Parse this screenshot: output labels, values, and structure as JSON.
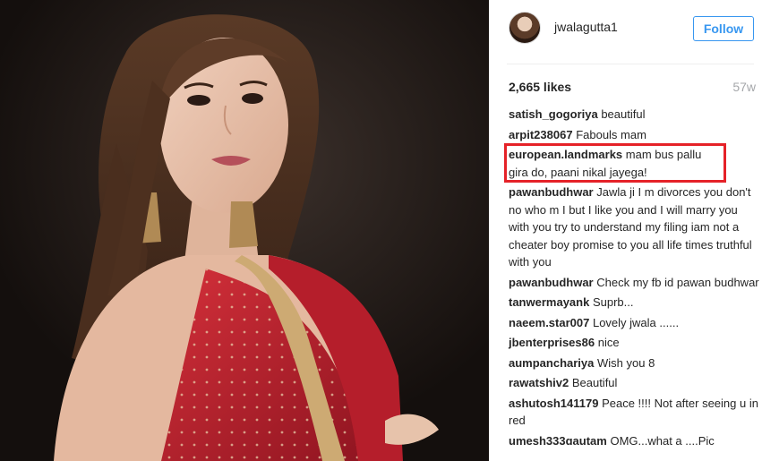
{
  "post": {
    "username": "jwalagutta1",
    "follow_label": "Follow",
    "likes": "2,665 likes",
    "age": "57w"
  },
  "comments": [
    {
      "author": "satish_gogoriya",
      "text": "beautiful"
    },
    {
      "author": "arpit238067",
      "text": "Fabouls mam"
    },
    {
      "author": "european.landmarks",
      "text": "mam bus pallu gira do, paani nikal jayega!"
    },
    {
      "author": "pawanbudhwar",
      "text": "Jawla ji I m divorces you don't no who m I but I like you and I will marry you with you try to understand my filing iam not a cheater boy promise to you all life times truthful with you"
    },
    {
      "author": "pawanbudhwar",
      "text": "Check my fb id pawan budhwar"
    },
    {
      "author": "tanwermayank",
      "text": "Suprb..."
    },
    {
      "author": "naeem.star007",
      "text": "Lovely jwala ......"
    },
    {
      "author": "jbenterprises86",
      "text": "nice"
    },
    {
      "author": "aumpanchariya",
      "text": "Wish you 8"
    },
    {
      "author": "rawatshiv2",
      "text": "Beautiful"
    },
    {
      "author": "ashutosh141179",
      "text": "Peace !!!! Not after seeing u in red"
    },
    {
      "author": "umesh333gautam",
      "text": "OMG...what a ....Pic"
    }
  ],
  "colors": {
    "highlight": "#e52228",
    "follow_blue": "#3897f0",
    "saree_red": "#c5232e"
  }
}
